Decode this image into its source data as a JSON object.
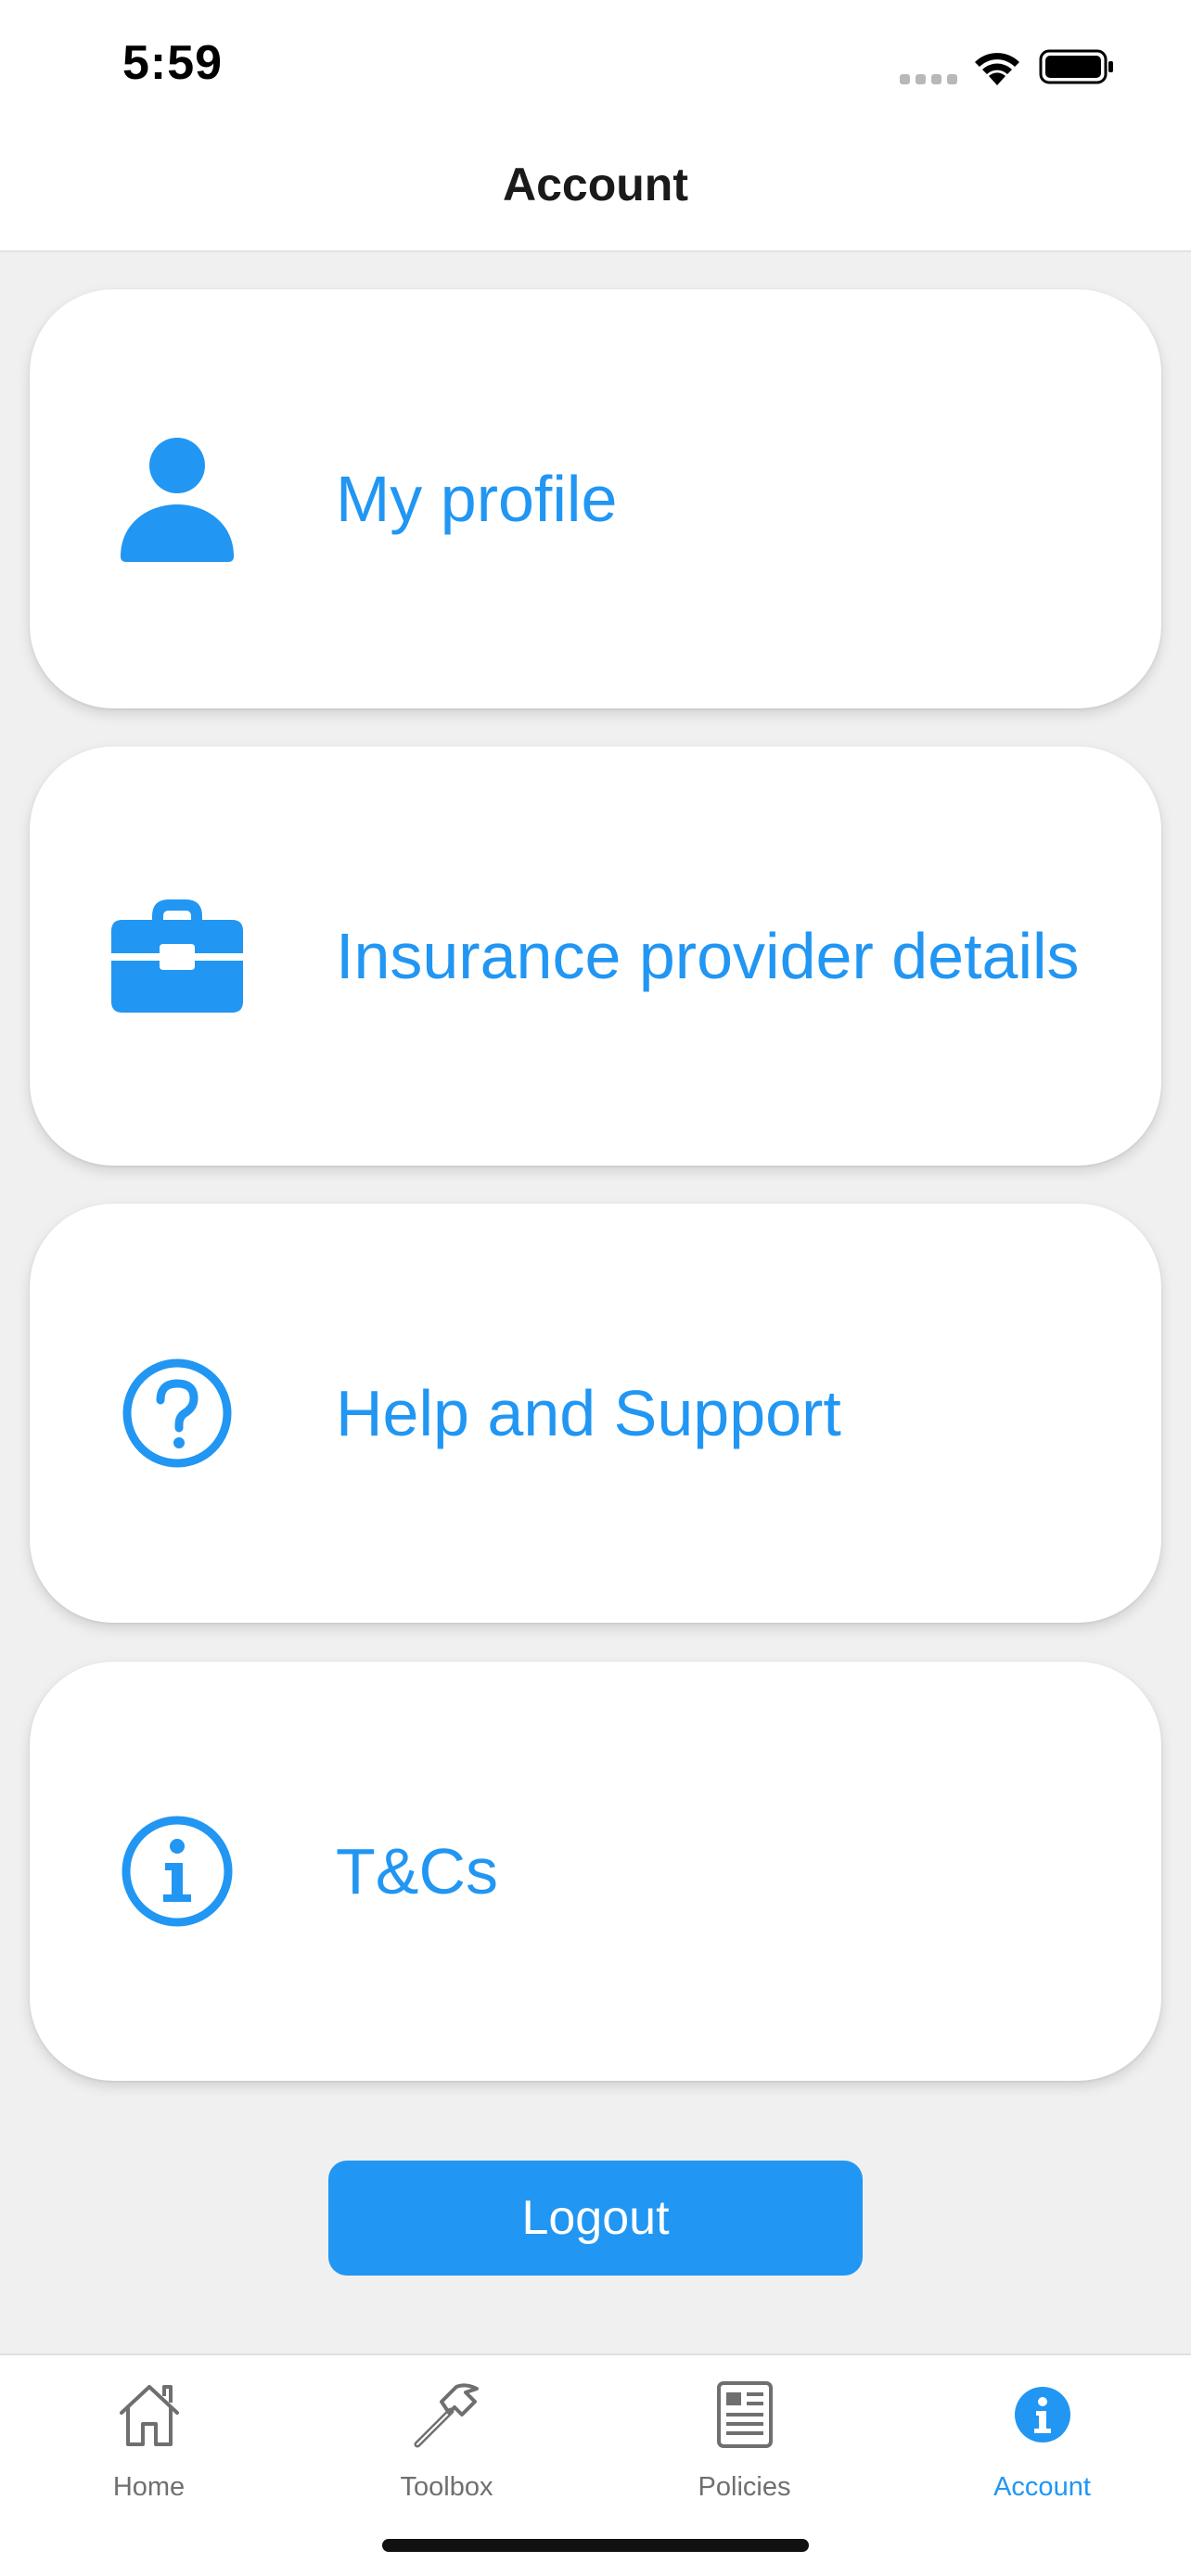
{
  "status_bar": {
    "time": "5:59"
  },
  "header": {
    "title": "Account"
  },
  "colors": {
    "accent": "#2196f3",
    "background": "#f0f0f0",
    "inactive_tab": "#6f6f6f"
  },
  "menu": [
    {
      "label": "My profile",
      "icon": "person-icon"
    },
    {
      "label": "Insurance provider details",
      "icon": "briefcase-icon"
    },
    {
      "label": "Help and Support",
      "icon": "help-circle-icon"
    },
    {
      "label": "T&Cs",
      "icon": "info-circle-icon"
    }
  ],
  "logout": {
    "label": "Logout"
  },
  "tabbar": {
    "active": "Account",
    "tabs": [
      {
        "label": "Home",
        "icon": "home-icon"
      },
      {
        "label": "Toolbox",
        "icon": "hammer-icon"
      },
      {
        "label": "Policies",
        "icon": "newspaper-icon"
      },
      {
        "label": "Account",
        "icon": "info-circle-icon"
      }
    ]
  }
}
